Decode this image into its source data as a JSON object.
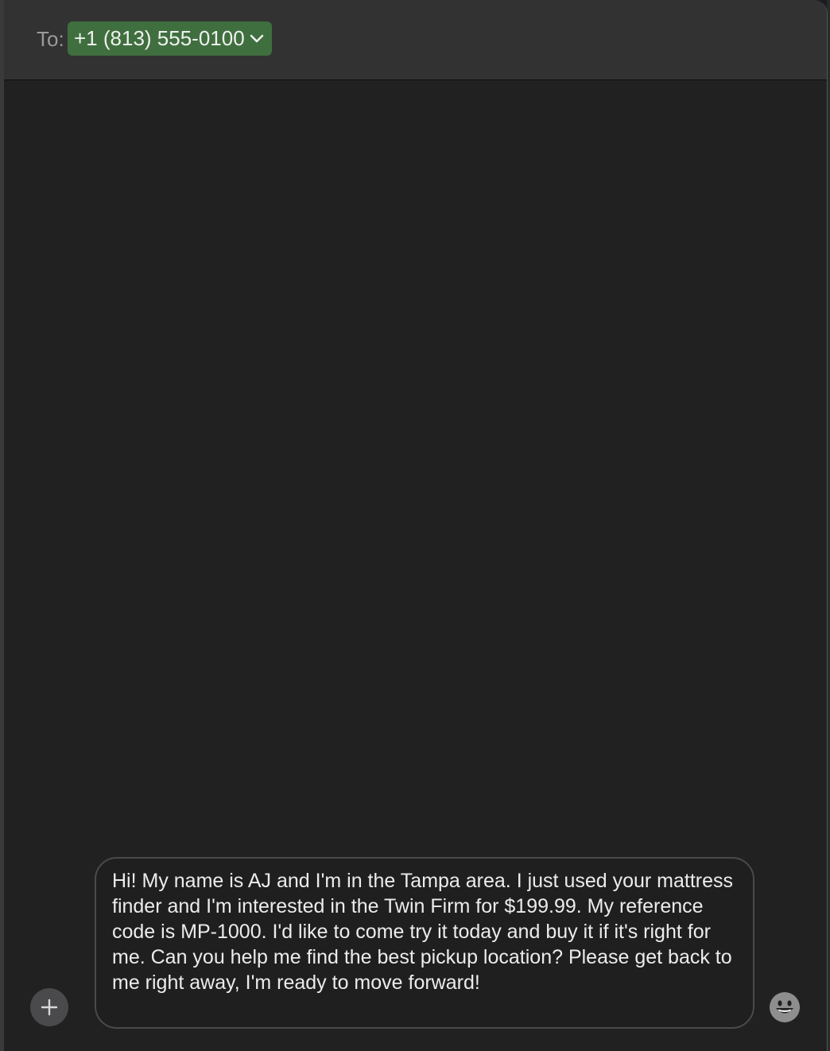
{
  "header": {
    "to_label": "To:",
    "recipient": "+1 (813) 555-0100"
  },
  "compose": {
    "message": "Hi! My name is AJ and I'm in the Tampa area. I just used your mattress finder and I'm interested in the Twin Firm for $199.99. My reference code is MP-1000. I'd like to come try it today and buy it if it's right for me. Can you help me find the best pickup location? Please get back to me right away, I'm ready to move forward!"
  },
  "icons": {
    "add": "plus-icon",
    "emoji": "smiley-icon",
    "chevron": "chevron-down-icon"
  },
  "colors": {
    "chip_background": "#3f6f3e",
    "window_background": "#212121",
    "header_background": "#323232"
  }
}
